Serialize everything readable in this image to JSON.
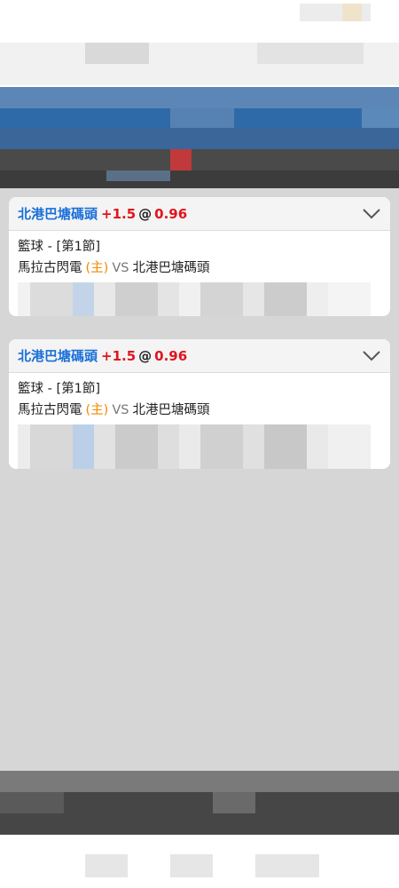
{
  "bets": [
    {
      "pick_team": "北港巴塘碼頭",
      "handicap": "+1.5",
      "at": "@",
      "odds": "0.96",
      "sport_period": "籃球 - [第1節]",
      "home_team": "馬拉古閃電",
      "home_tag": "(主)",
      "vs": "VS",
      "away_team": "北港巴塘碼頭"
    },
    {
      "pick_team": "北港巴塘碼頭",
      "handicap": "+1.5",
      "at": "@",
      "odds": "0.96",
      "sport_period": "籃球 - [第1節]",
      "home_team": "馬拉古閃電",
      "home_tag": "(主)",
      "vs": "VS",
      "away_team": "北港巴塘碼頭"
    }
  ],
  "icons": {
    "expand": "chevron-down-icon"
  },
  "colors": {
    "pick_team": "#1a6fd8",
    "odds": "#e0141f",
    "home_tag": "#f08a00",
    "header": "#2f6aa8",
    "content_bg": "#d6d6d6"
  }
}
